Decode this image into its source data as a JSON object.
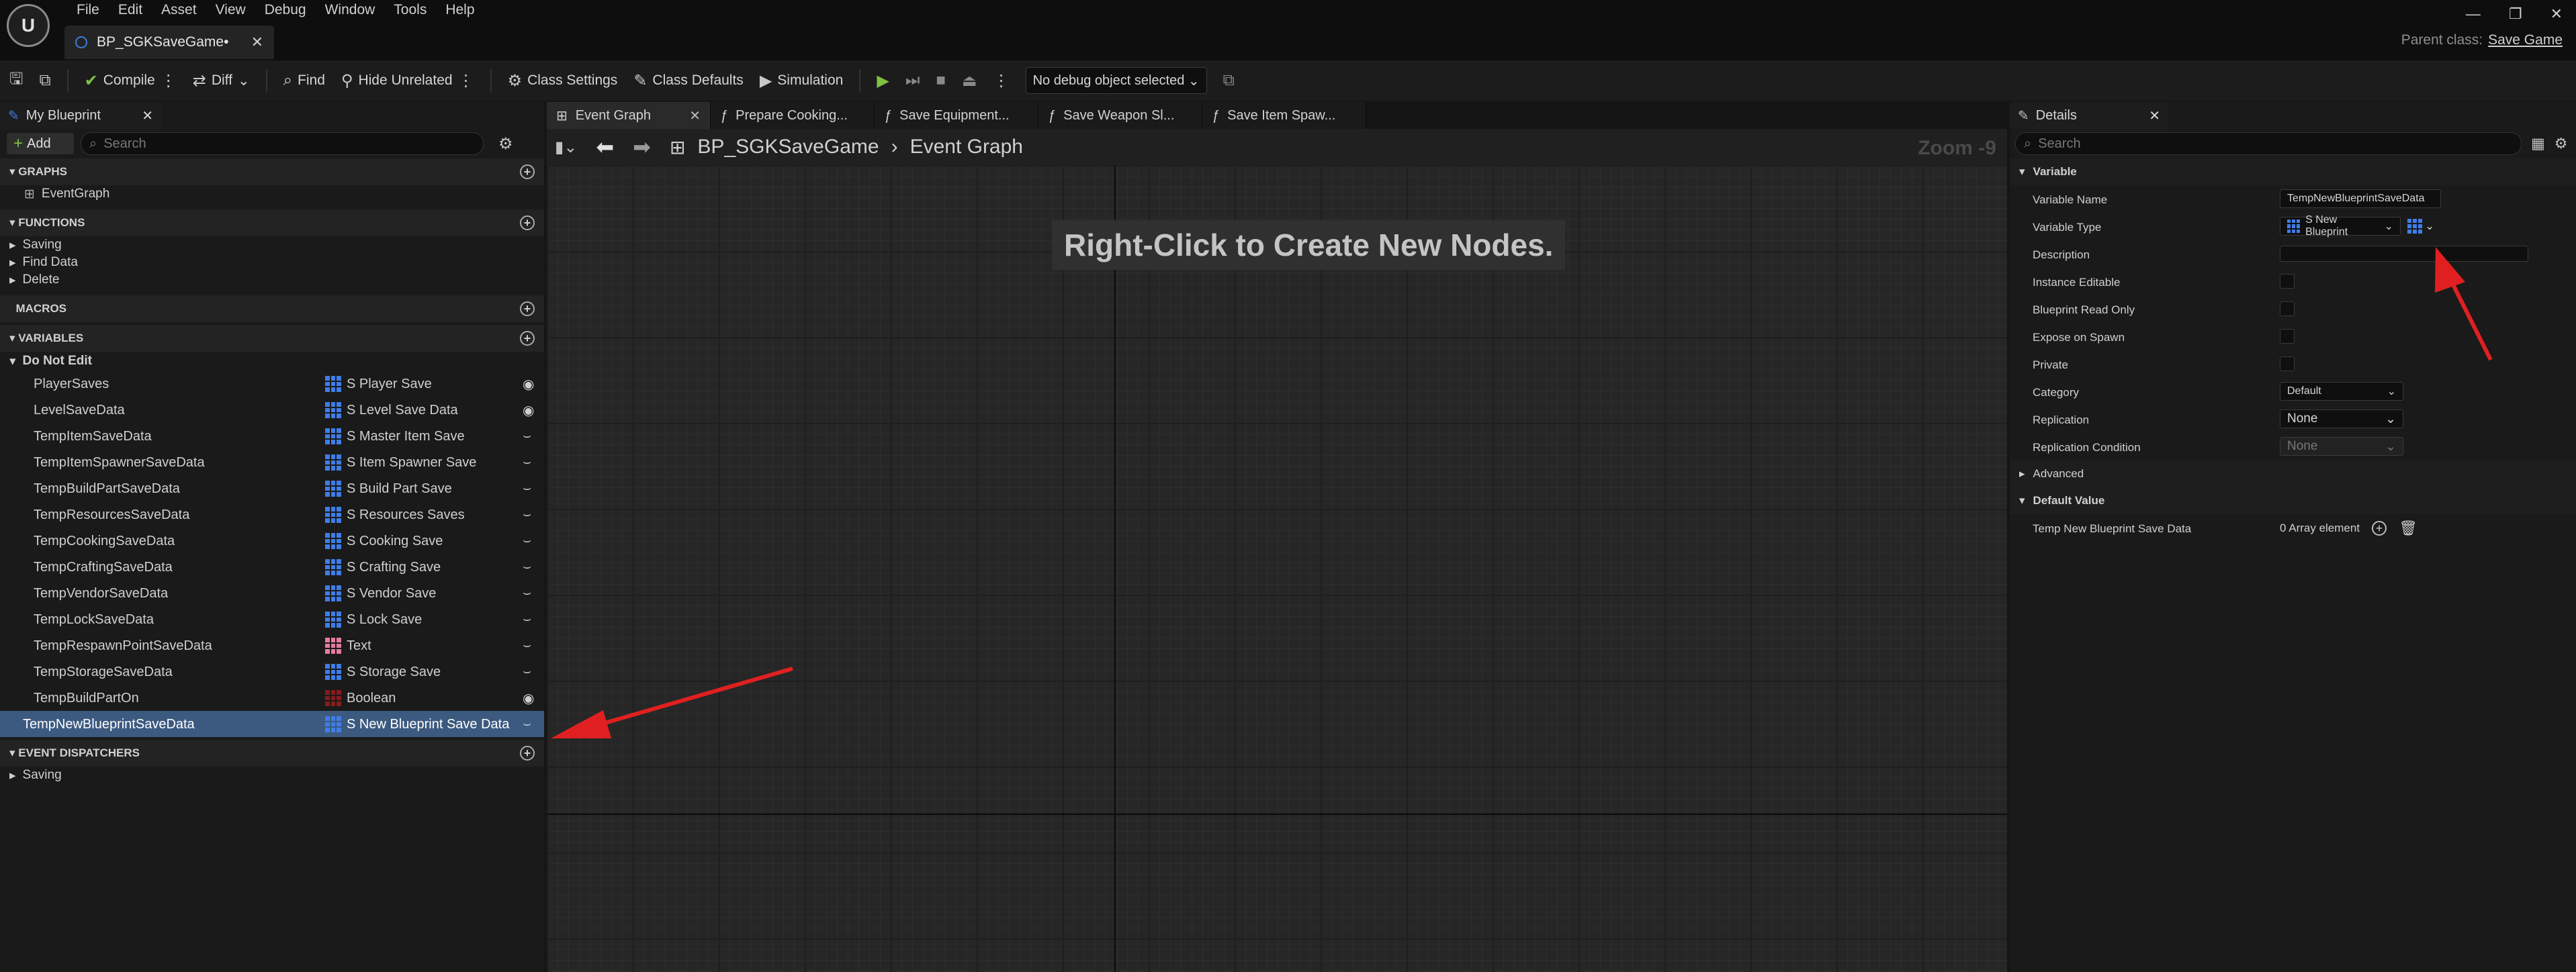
{
  "menu": [
    "File",
    "Edit",
    "Asset",
    "View",
    "Debug",
    "Window",
    "Tools",
    "Help"
  ],
  "document_tab": "BP_SGKSaveGame•",
  "parent_class": {
    "label": "Parent class:",
    "value": "Save Game"
  },
  "window_controls": {
    "minimize": "—",
    "restore": "❐",
    "close": "✕"
  },
  "toolbar": {
    "compile": "Compile",
    "diff": "Diff",
    "find": "Find",
    "hide_unrelated": "Hide Unrelated",
    "class_settings": "Class Settings",
    "class_defaults": "Class Defaults",
    "simulation": "Simulation",
    "debug_object": "No debug object selected"
  },
  "my_blueprint": {
    "tab": "My Blueprint",
    "add": "Add",
    "search_placeholder": "Search",
    "graphs_header": "GRAPHS",
    "graphs": [
      "EventGraph"
    ],
    "functions_header": "FUNCTIONS",
    "functions": [
      "Saving",
      "Find Data",
      "Delete"
    ],
    "macros_header": "MACROS",
    "variables_header": "VARIABLES",
    "variable_category": "Do Not Edit",
    "variables": [
      {
        "name": "PlayerSaves",
        "type": "S Player Save",
        "icon": "struct",
        "vis": "eye"
      },
      {
        "name": "LevelSaveData",
        "type": "S Level Save Data",
        "icon": "struct",
        "vis": "eye"
      },
      {
        "name": "TempItemSaveData",
        "type": "S Master Item Save",
        "icon": "struct",
        "vis": "hidden"
      },
      {
        "name": "TempItemSpawnerSaveData",
        "type": "S Item Spawner Save",
        "icon": "struct",
        "vis": "hidden"
      },
      {
        "name": "TempBuildPartSaveData",
        "type": "S Build Part Save",
        "icon": "struct",
        "vis": "hidden"
      },
      {
        "name": "TempResourcesSaveData",
        "type": "S Resources Saves",
        "icon": "struct",
        "vis": "hidden"
      },
      {
        "name": "TempCookingSaveData",
        "type": "S Cooking Save",
        "icon": "struct",
        "vis": "hidden"
      },
      {
        "name": "TempCraftingSaveData",
        "type": "S Crafting Save",
        "icon": "struct",
        "vis": "hidden"
      },
      {
        "name": "TempVendorSaveData",
        "type": "S Vendor Save",
        "icon": "struct",
        "vis": "hidden"
      },
      {
        "name": "TempLockSaveData",
        "type": "S Lock Save",
        "icon": "struct",
        "vis": "hidden"
      },
      {
        "name": "TempRespawnPointSaveData",
        "type": "Text",
        "icon": "text",
        "vis": "hidden"
      },
      {
        "name": "TempStorageSaveData",
        "type": "S Storage Save",
        "icon": "struct",
        "vis": "hidden"
      },
      {
        "name": "TempBuildPartOn",
        "type": "Boolean",
        "icon": "bool",
        "vis": "eye"
      },
      {
        "name": "TempNewBlueprintSaveData",
        "type": "S New Blueprint Save Data",
        "icon": "struct",
        "vis": "hidden"
      }
    ],
    "dispatchers_header": "EVENT DISPATCHERS",
    "dispatchers": [
      "Saving"
    ]
  },
  "graph": {
    "tabs": [
      "Event Graph",
      "Prepare Cooking...",
      "Save Equipment...",
      "Save Weapon Sl...",
      "Save Item Spaw..."
    ],
    "breadcrumb_root": "BP_SGKSaveGame",
    "breadcrumb_current": "Event Graph",
    "zoom": "Zoom -9",
    "hint": "Right-Click to Create New Nodes."
  },
  "details": {
    "tab": "Details",
    "search_placeholder": "Search",
    "variable_section": "Variable",
    "variable_name_label": "Variable Name",
    "variable_name": "TempNewBlueprintSaveData",
    "variable_type_label": "Variable Type",
    "variable_type": "S New Blueprint",
    "description_label": "Description",
    "instance_editable_label": "Instance Editable",
    "blueprint_read_only_label": "Blueprint Read Only",
    "expose_on_spawn_label": "Expose on Spawn",
    "private_label": "Private",
    "category_label": "Category",
    "category": "Default",
    "replication_label": "Replication",
    "replication": "None",
    "replication_condition_label": "Replication Condition",
    "replication_condition": "None",
    "advanced_section": "Advanced",
    "default_value_section": "Default Value",
    "default_value_label": "Temp New Blueprint Save Data",
    "default_value": "0 Array element"
  },
  "colors": {
    "accent": "#3f7de8",
    "selection": "#3c5a80",
    "annotation": "#e02020",
    "play": "#7fc242"
  }
}
